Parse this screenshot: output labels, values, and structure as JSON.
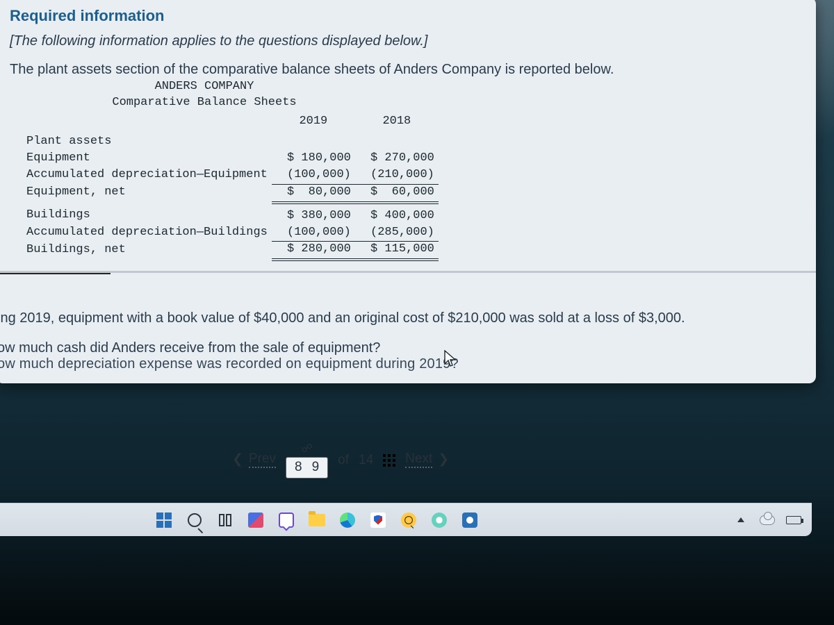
{
  "heading": "Required information",
  "intro": "[The following information applies to the questions displayed below.]",
  "lead": "The plant assets section of the comparative balance sheets of Anders Company is reported below.",
  "sheet": {
    "company": "ANDERS COMPANY",
    "title": "Comparative Balance Sheets",
    "year_cols": [
      "2019",
      "2018"
    ],
    "section": "Plant assets",
    "rows": [
      {
        "label": "Equipment",
        "y2019": "$ 180,000",
        "y2018": "$ 270,000"
      },
      {
        "label": "Accumulated depreciation—Equipment",
        "y2019": "(100,000)",
        "y2018": "(210,000)"
      },
      {
        "label": "Equipment, net",
        "y2019": "$  80,000",
        "y2018": "$  60,000"
      },
      {
        "label": "Buildings",
        "y2019": "$ 380,000",
        "y2018": "$ 400,000"
      },
      {
        "label": "Accumulated depreciation—Buildings",
        "y2019": "(100,000)",
        "y2018": "(285,000)"
      },
      {
        "label": "Buildings, net",
        "y2019": "$ 280,000",
        "y2018": "$ 115,000"
      }
    ]
  },
  "question": {
    "line1": "ing 2019, equipment with a book value of $40,000 and an original cost of $210,000 was sold at a loss of $3,000.",
    "line2": "ow much cash did Anders receive from the sale of equipment?",
    "line3": "ow much depreciation expense was recorded on equipment during 2019?"
  },
  "pager": {
    "prev": "Prev",
    "nums": [
      "8",
      "9"
    ],
    "of_text": "of",
    "total": "14",
    "next": "Next"
  }
}
